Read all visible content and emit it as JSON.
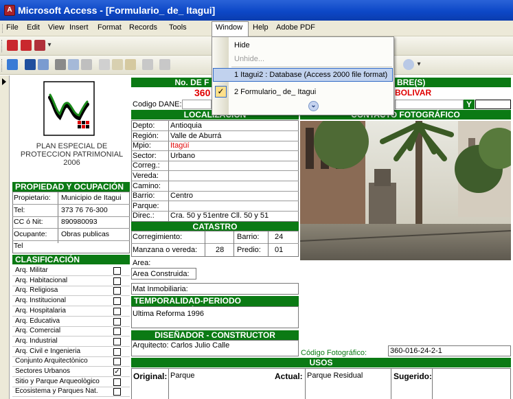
{
  "window": {
    "title": "Microsoft Access - [Formulario_ de_ Itagui]",
    "app_icon": "A"
  },
  "menu": {
    "items": [
      "File",
      "Edit",
      "View",
      "Insert",
      "Format",
      "Records",
      "Tools",
      "Window",
      "Help",
      "Adobe PDF"
    ]
  },
  "dropdown": {
    "hide": "Hide",
    "unhide": "Unhide...",
    "item1": "1 Itagui2 : Database (Access 2000 file format)",
    "item2": "2 Formulario_ de_ Itagui",
    "check": "✓",
    "expand": "⌄"
  },
  "form": {
    "header_no": "No. DE F",
    "header_no_value": "360",
    "header_nombre": "BRE(S)",
    "header_nombre_value": "BOLIVAR",
    "codigo_dane_label": "Codigo DANE:",
    "y_label": "Y",
    "logo_caption": "PLAN ESPECIAL DE PROTECCION PATRIMONIAL 2006",
    "localizacion": {
      "title": "LOCALIZACIÓN",
      "rows": [
        {
          "label": "Depto:",
          "value": "Antioquia",
          "red": false
        },
        {
          "label": "Región:",
          "value": "Valle de Aburrá",
          "red": false
        },
        {
          "label": "Mpio:",
          "value": "Itagüí",
          "red": true
        },
        {
          "label": "Sector:",
          "value": "Urbano",
          "red": false
        },
        {
          "label": "Correg.:",
          "value": "",
          "red": false
        },
        {
          "label": "Vereda:",
          "value": "",
          "red": false
        },
        {
          "label": "Camino:",
          "value": "",
          "red": false
        },
        {
          "label": "Barrio:",
          "value": "Centro",
          "red": false
        },
        {
          "label": "Parque:",
          "value": "",
          "red": false
        },
        {
          "label": "Direc.:",
          "value": "Cra. 50 y 51entre Cll. 50 y 51",
          "red": false
        }
      ]
    },
    "contacto_title": "CONTACTO FOTOGRÁFICO",
    "propiedad": {
      "title": "PROPIEDAD Y OCUPACIÓN",
      "rows": [
        {
          "label": "Propietario:",
          "value": "Municipio de Itagui"
        },
        {
          "label": "Tel:",
          "value": "373 76 76-300"
        },
        {
          "label": "CC ó Nit:",
          "value": "890980093"
        },
        {
          "label": "Ocupante:",
          "value": "Obras publicas"
        },
        {
          "label": "Tel",
          "value": ""
        }
      ]
    },
    "clasificacion": {
      "title": "CLASIFICACIÓN TIPOLÓGICA",
      "items": [
        {
          "label": "Arq. Militar",
          "checked": false
        },
        {
          "label": "Arq. Habitacional",
          "checked": false
        },
        {
          "label": "Arq. Religiosa",
          "checked": false
        },
        {
          "label": "Arq. Institucional",
          "checked": false
        },
        {
          "label": "Arq. Hospitalaria",
          "checked": false
        },
        {
          "label": "Arq. Educativa",
          "checked": false
        },
        {
          "label": "Arq. Comercial",
          "checked": false
        },
        {
          "label": "Arq. Industrial",
          "checked": false
        },
        {
          "label": "Arq. Civil e Ingenieria",
          "checked": false
        },
        {
          "label": "Conjunto Arquitectònico",
          "checked": false
        },
        {
          "label": "Sectores Urbanos",
          "checked": true
        },
        {
          "label": "Sitio y Parque Arqueològico",
          "checked": false
        },
        {
          "label": "Ecosistema y Parques Nat.",
          "checked": false
        }
      ]
    },
    "catastro": {
      "title": "CATASTRO",
      "corregimiento": "Corregimiento:",
      "barrio_label": "Barrio:",
      "barrio_value": "24",
      "manzana_label": "Manzana o vereda:",
      "manzana_value": "28",
      "predio_label": "Predio:",
      "predio_value": "01",
      "area": "Area:",
      "area_construida": "Area Construida:",
      "mat": "Mat Inmobiliaria:"
    },
    "temporalidad": {
      "title": "TEMPORALIDAD-PERIODO CONSTRUCCIÓN",
      "value": "Ultima Reforma 1996"
    },
    "disenador": {
      "title": "DISEÑADOR - CONSTRUCTOR",
      "value": "Arquitecto: Carlos Julio Calle"
    },
    "codigo_foto_label": "Código Fotográfico:",
    "codigo_foto_value": "360-016-24-2-1",
    "usos": {
      "title": "USOS",
      "original_label": "Original:",
      "original_value": "Parque",
      "actual_label": "Actual:",
      "actual_value": "Parque Residual",
      "sugerido_label": "Sugerido:"
    }
  },
  "colors": {
    "header_green": "#0b7a14",
    "title_blue": "#0d48c7",
    "red": "#e00000"
  }
}
